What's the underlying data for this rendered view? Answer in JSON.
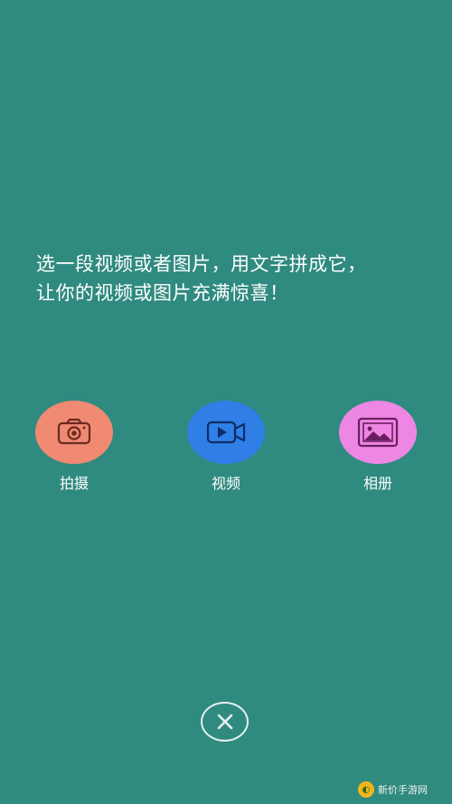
{
  "intro": {
    "line1": "选一段视频或者图片，用文字拼成它，",
    "line2": "让你的视频或图片充满惊喜！"
  },
  "actions": [
    {
      "label": "拍摄",
      "icon": "camera-icon",
      "color": "#f08a72",
      "icon_color": "#6a2a1f"
    },
    {
      "label": "视频",
      "icon": "video-camera-icon",
      "color": "#2f7fe6",
      "icon_color": "#0f2d66"
    },
    {
      "label": "相册",
      "icon": "image-gallery-icon",
      "color": "#ee86e3",
      "icon_color": "#6b1f62"
    }
  ],
  "close": {
    "icon": "close-icon"
  },
  "watermark": {
    "text": "新价手游网"
  },
  "colors": {
    "background": "#2f8a7f",
    "text": "#ffffff"
  }
}
